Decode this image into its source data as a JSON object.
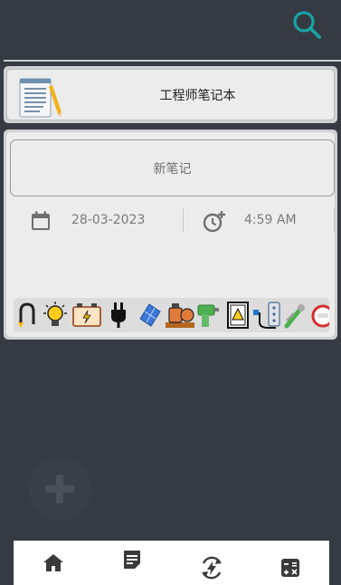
{
  "header": {
    "search_icon": "search-icon",
    "accent": "#1aa3a3"
  },
  "notebook": {
    "title": "工程师笔记本",
    "icon": "notepad-icon"
  },
  "note_editor": {
    "new_note_label": "新笔记",
    "date": "28-03-2023",
    "time": "4:59 AM",
    "date_icon": "calendar-icon",
    "time_icon": "clock-add-icon"
  },
  "tools": [
    "hook-icon",
    "lightbulb-icon",
    "battery-icon",
    "plug-icon",
    "solar-panel-icon",
    "motor-pump-icon",
    "drill-icon",
    "electrical-panel-icon",
    "power-strip-icon",
    "wrench-icon",
    "meter-icon"
  ],
  "fab": {
    "icon": "plus-icon"
  },
  "bottom_nav": [
    {
      "name": "home",
      "icon": "home-icon"
    },
    {
      "name": "notes",
      "icon": "notes-icon"
    },
    {
      "name": "energy",
      "icon": "energy-cycle-icon"
    },
    {
      "name": "calculator",
      "icon": "calculator-icon"
    }
  ]
}
